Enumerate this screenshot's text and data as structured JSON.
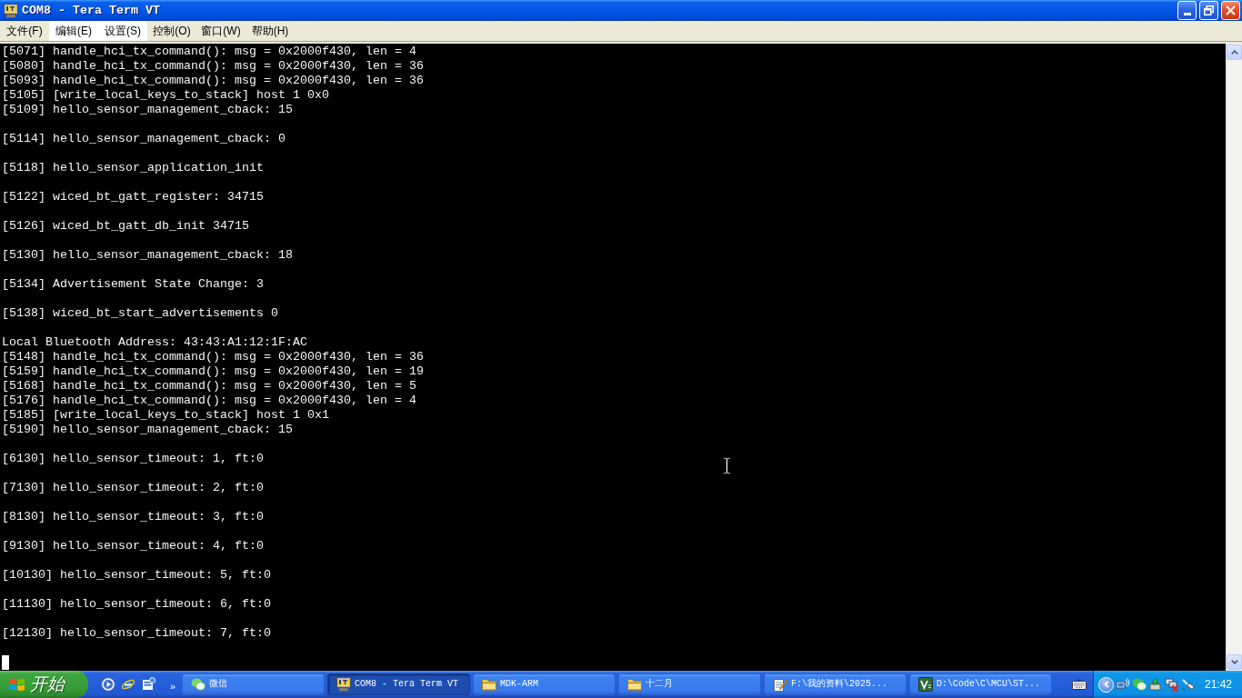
{
  "window": {
    "title": "COM8 - Tera Term VT"
  },
  "menu_bar": [
    {
      "label": "文件(F)",
      "highlighted": false
    },
    {
      "label": "编辑(E)",
      "highlighted": true
    },
    {
      "label": "设置(S)",
      "highlighted": true
    },
    {
      "label": "控制(O)",
      "highlighted": false
    },
    {
      "label": "窗口(W)",
      "highlighted": false
    },
    {
      "label": "帮助(H)",
      "highlighted": false
    }
  ],
  "terminal": {
    "blocks": [
      [
        "[5071] handle_hci_tx_command(): msg = 0x2000f430, len = 4",
        "[5080] handle_hci_tx_command(): msg = 0x2000f430, len = 36",
        "[5093] handle_hci_tx_command(): msg = 0x2000f430, len = 36",
        "[5105] [write_local_keys_to_stack] host 1 0x0",
        "[5109] hello_sensor_management_cback: 15"
      ],
      [
        "[5114] hello_sensor_management_cback: 0"
      ],
      [
        "[5118] hello_sensor_application_init"
      ],
      [
        "[5122] wiced_bt_gatt_register: 34715"
      ],
      [
        "[5126] wiced_bt_gatt_db_init 34715"
      ],
      [
        "[5130] hello_sensor_management_cback: 18"
      ],
      [
        "[5134] Advertisement State Change: 3"
      ],
      [
        "[5138] wiced_bt_start_advertisements 0"
      ],
      [
        "Local Bluetooth Address: 43:43:A1:12:1F:AC",
        "[5148] handle_hci_tx_command(): msg = 0x2000f430, len = 36",
        "[5159] handle_hci_tx_command(): msg = 0x2000f430, len = 19",
        "[5168] handle_hci_tx_command(): msg = 0x2000f430, len = 5",
        "[5176] handle_hci_tx_command(): msg = 0x2000f430, len = 4",
        "[5185] [write_local_keys_to_stack] host 1 0x1",
        "[5190] hello_sensor_management_cback: 15"
      ],
      [
        "[6130] hello_sensor_timeout: 1, ft:0"
      ],
      [
        "[7130] hello_sensor_timeout: 2, ft:0"
      ],
      [
        "[8130] hello_sensor_timeout: 3, ft:0"
      ],
      [
        "[9130] hello_sensor_timeout: 4, ft:0"
      ],
      [
        "[10130] hello_sensor_timeout: 5, ft:0"
      ],
      [
        "[11130] hello_sensor_timeout: 6, ft:0"
      ],
      [
        "[12130] hello_sensor_timeout: 7, ft:0"
      ]
    ],
    "cursor_visible": true
  },
  "taskbar": {
    "start_label": "开始",
    "quick_launch_more": "»",
    "buttons": [
      {
        "label": "微信",
        "kind": "chat",
        "selected": false
      },
      {
        "label": "COM8 - Tera Term VT",
        "kind": "terminal",
        "selected": true
      },
      {
        "label": "MDK-ARM",
        "kind": "folder",
        "selected": false
      },
      {
        "label": "十二月",
        "kind": "folder",
        "selected": false
      },
      {
        "label": "F:\\我的资料\\2025...",
        "kind": "notepad",
        "selected": false
      },
      {
        "label": "D:\\Code\\C\\MCU\\ST...",
        "kind": "vs",
        "selected": false
      }
    ],
    "clock": "21:42"
  }
}
